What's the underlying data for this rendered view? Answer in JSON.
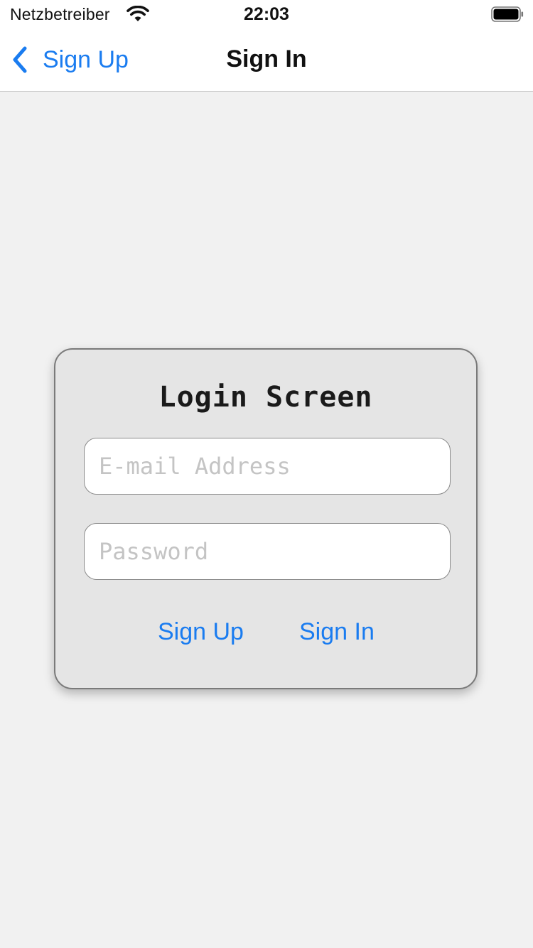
{
  "status_bar": {
    "carrier": "Netzbetreiber",
    "time": "22:03"
  },
  "nav": {
    "back_label": "Sign Up",
    "title": "Sign In"
  },
  "login_card": {
    "title": "Login Screen",
    "email_placeholder": "E-mail Address",
    "password_placeholder": "Password",
    "signup_label": "Sign Up",
    "signin_label": "Sign In"
  },
  "colors": {
    "accent": "#1a7cf0",
    "background": "#f1f1f1",
    "card_background": "#e5e5e5",
    "placeholder": "#c4c4c4"
  },
  "icons": [
    "wifi-icon",
    "battery-icon",
    "chevron-left-icon"
  ]
}
